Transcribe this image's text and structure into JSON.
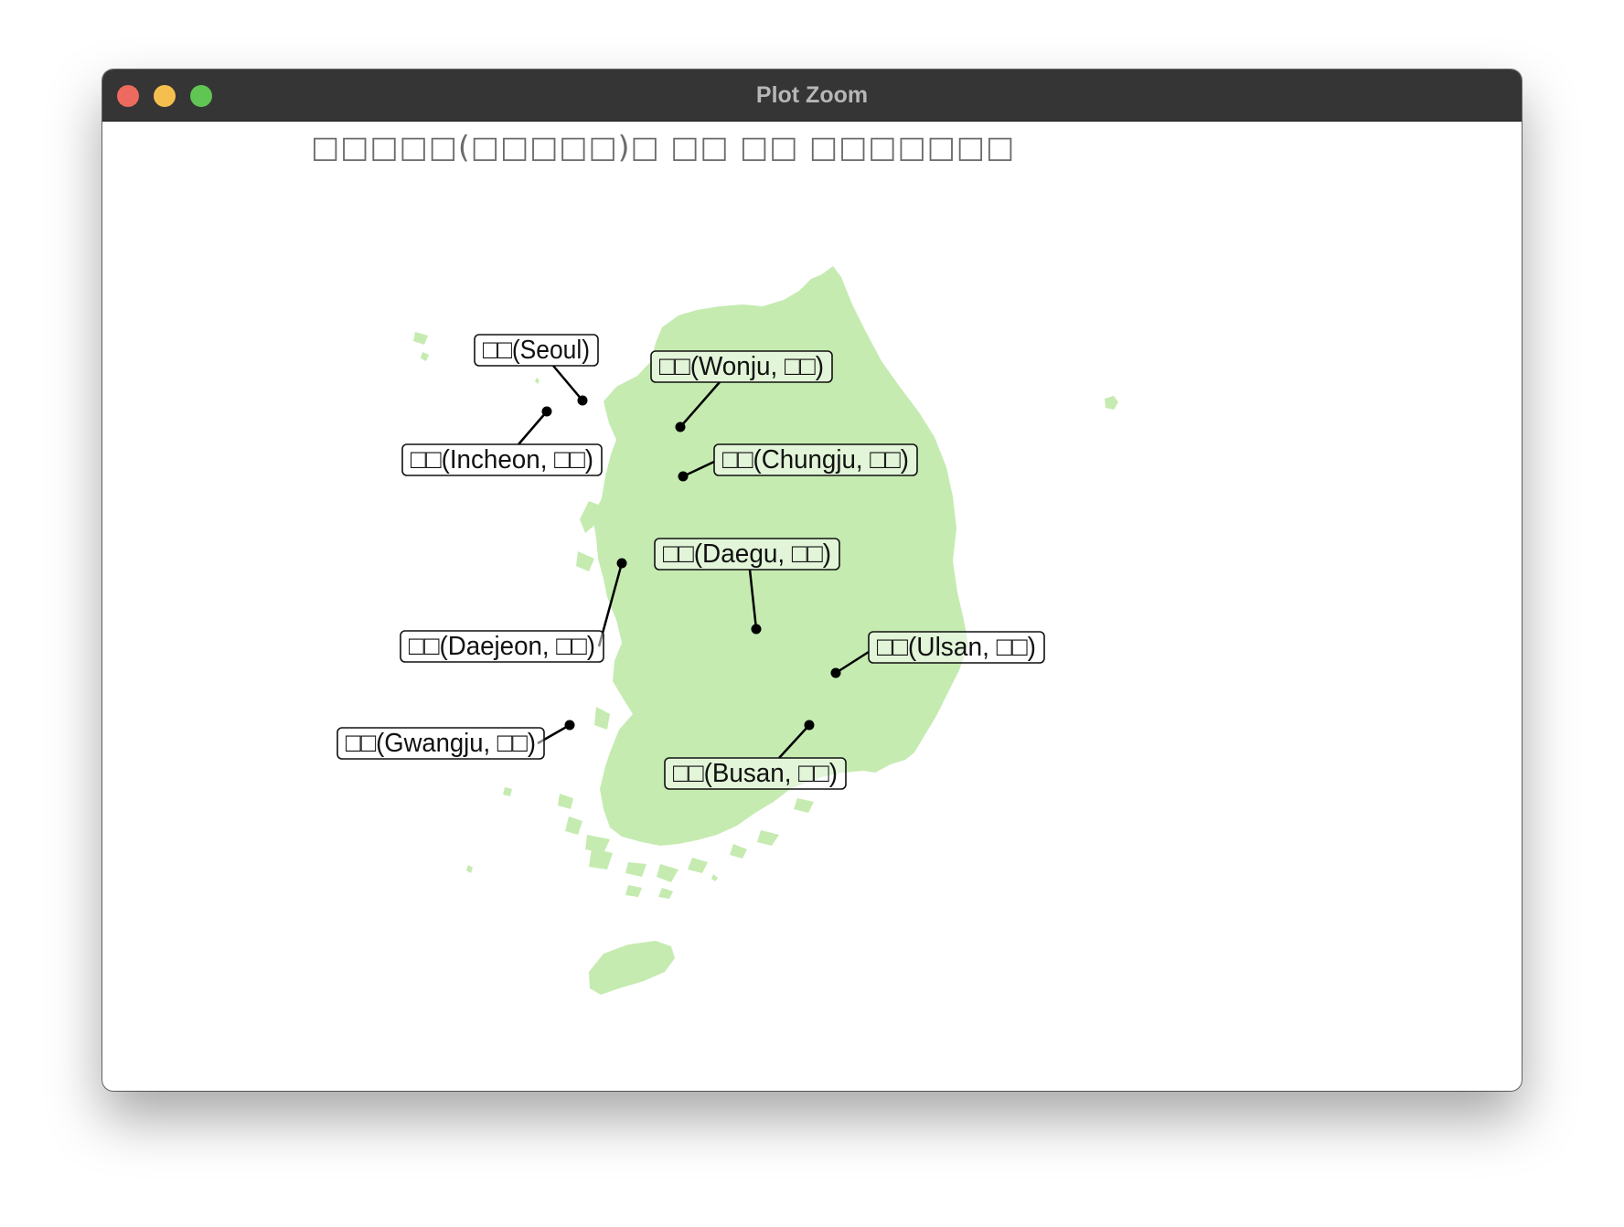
{
  "window": {
    "title": "Plot Zoom"
  },
  "plot": {
    "title": "□□□□□(□□□□□)□ □□ □□ □□□□□□□",
    "land_color": "#c5ebb1",
    "marker_color": "#000000"
  },
  "map_labels": [
    {
      "id": "seoul",
      "text": "□□(Seoul)"
    },
    {
      "id": "wonju",
      "text": "□□(Wonju, □□)"
    },
    {
      "id": "incheon",
      "text": "□□(Incheon, □□)"
    },
    {
      "id": "chungju",
      "text": "□□(Chungju, □□)"
    },
    {
      "id": "daegu",
      "text": "□□(Daegu, □□)"
    },
    {
      "id": "daejeon",
      "text": "□□(Daejeon, □□)"
    },
    {
      "id": "ulsan",
      "text": "□□(Ulsan, □□)"
    },
    {
      "id": "gwangju",
      "text": "□□(Gwangju, □□)"
    },
    {
      "id": "busan",
      "text": "□□(Busan, □□)"
    }
  ]
}
